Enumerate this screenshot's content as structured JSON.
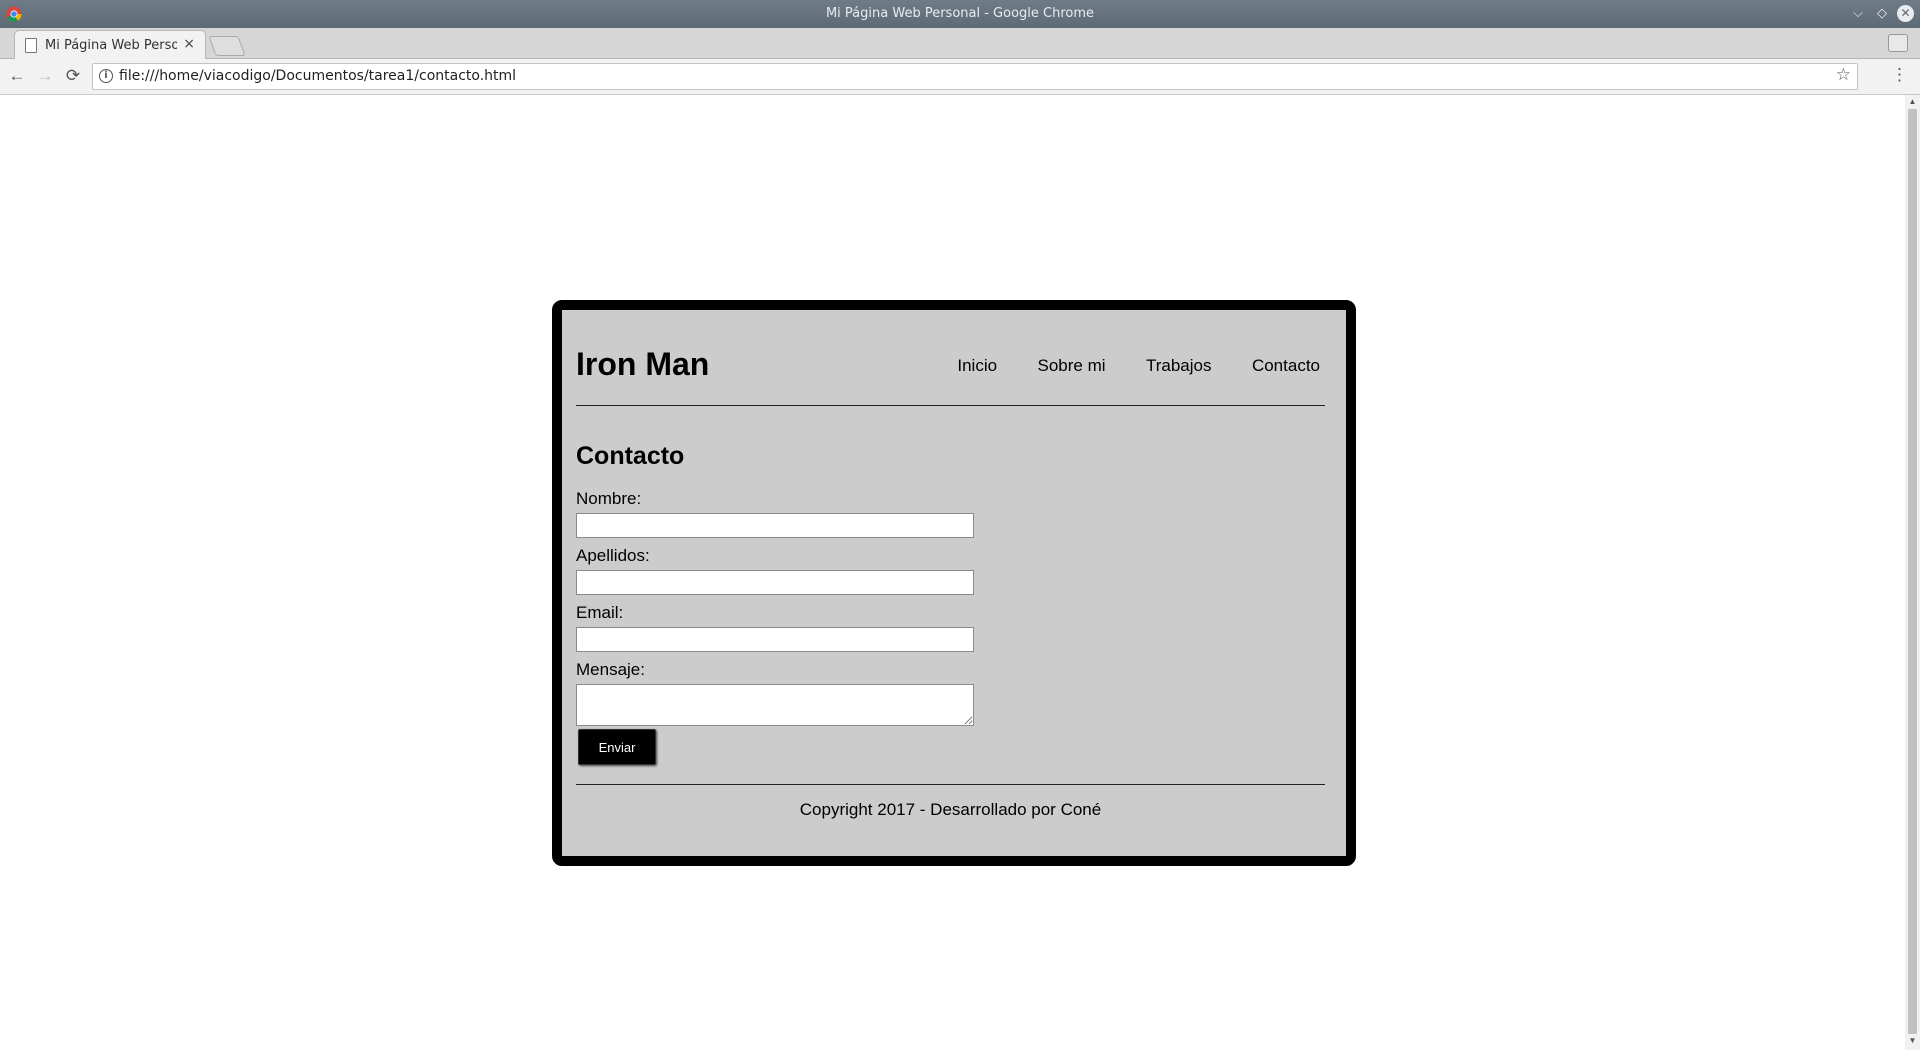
{
  "window": {
    "title": "Mi Página Web Personal - Google Chrome",
    "controls": {
      "minimize": "⌵",
      "restore": "◇",
      "close": "✕"
    }
  },
  "tabs": [
    {
      "label": "Mi Página Web Personal",
      "close": "×"
    }
  ],
  "toolbar": {
    "back": "←",
    "forward": "→",
    "reload": "⟳",
    "url": "file:///home/viacodigo/Documentos/tarea1/contacto.html",
    "info_icon": "i",
    "star": "☆",
    "menu": "⋮"
  },
  "scrollbar": {
    "up": "▲",
    "down": "▼"
  },
  "site": {
    "title": "Iron Man",
    "nav": [
      "Inicio",
      "Sobre mi",
      "Trabajos",
      "Contacto"
    ],
    "section_title": "Contacto",
    "form": {
      "nombre_label": "Nombre:",
      "nombre_value": "",
      "apellidos_label": "Apellidos:",
      "apellidos_value": "",
      "email_label": "Email:",
      "email_value": "",
      "mensaje_label": "Mensaje:",
      "mensaje_value": "",
      "submit_label": "Enviar"
    },
    "footer": "Copyright 2017 - Desarrollado por Coné"
  }
}
